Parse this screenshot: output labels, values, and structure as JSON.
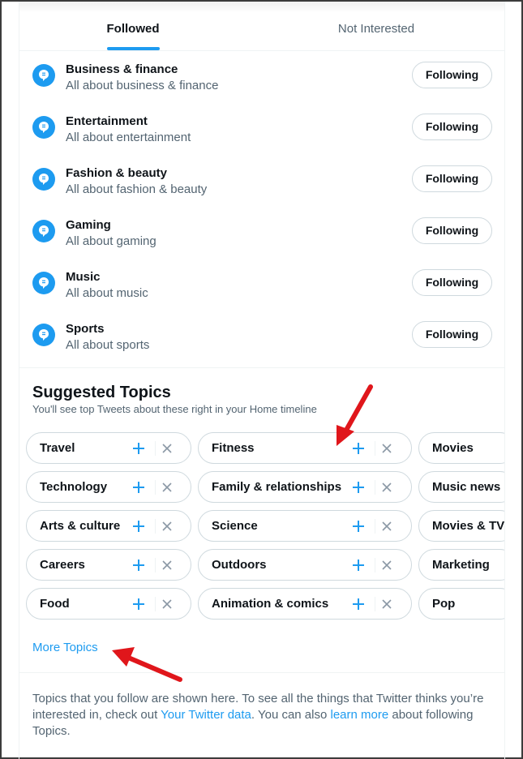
{
  "tabs": {
    "followed": "Followed",
    "not_interested": "Not Interested"
  },
  "followed_topics": [
    {
      "name": "Business & finance",
      "desc": "All about business & finance",
      "button": "Following"
    },
    {
      "name": "Entertainment",
      "desc": "All about entertainment",
      "button": "Following"
    },
    {
      "name": "Fashion & beauty",
      "desc": "All about fashion & beauty",
      "button": "Following"
    },
    {
      "name": "Gaming",
      "desc": "All about gaming",
      "button": "Following"
    },
    {
      "name": "Music",
      "desc": "All about music",
      "button": "Following"
    },
    {
      "name": "Sports",
      "desc": "All about sports",
      "button": "Following"
    }
  ],
  "suggested": {
    "title": "Suggested Topics",
    "subtitle": "You'll see top Tweets about these right in your Home timeline",
    "columns": [
      [
        "Travel",
        "Technology",
        "Arts & culture",
        "Careers",
        "Food"
      ],
      [
        "Fitness",
        "Family & relationships",
        "Science",
        "Outdoors",
        "Animation & comics"
      ],
      [
        "Movies",
        "Music news",
        "Movies & TV",
        "Marketing",
        "Pop"
      ]
    ]
  },
  "more_topics": "More Topics",
  "footer": {
    "text1": "Topics that you follow are shown here. To see all the things that Twitter thinks you’re interested in, check out ",
    "link1": "Your Twitter data",
    "text2": ". You can also ",
    "link2": "learn more",
    "text3": " about following Topics."
  },
  "colors": {
    "accent": "#1d9bf0",
    "annotation": "#e0161b",
    "muted": "#536471",
    "text": "#0f1419"
  }
}
